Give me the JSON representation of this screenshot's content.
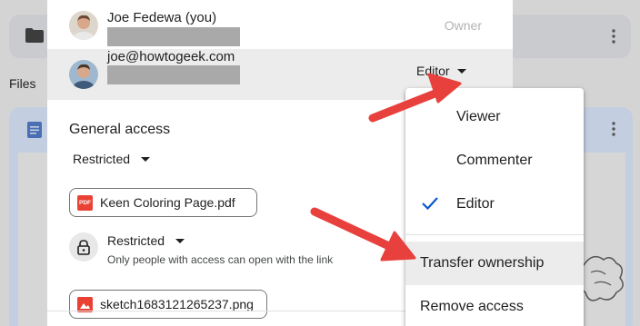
{
  "background": {
    "files_label": "Files"
  },
  "people": [
    {
      "name": "Joe Fedewa (you)",
      "role": "Owner"
    },
    {
      "name": "joe@howtogeek.com",
      "role": "Editor"
    }
  ],
  "general_access": {
    "title": "General access",
    "setting": "Restricted"
  },
  "files": {
    "pdf_name": "Keen Coloring Page.pdf",
    "pdf_badge": "PDF",
    "image_name": "sketch1683121265237.png"
  },
  "link_access": {
    "setting": "Restricted",
    "description": "Only people with access can open with the link"
  },
  "role_menu": {
    "items": [
      "Viewer",
      "Commenter",
      "Editor"
    ],
    "selected": "Editor",
    "transfer_label": "Transfer ownership",
    "remove_label": "Remove access"
  },
  "colors": {
    "accent": "#0b57d0",
    "arrow": "#e8413d",
    "pdf_red": "#e94235"
  },
  "icons": [
    "folder-icon",
    "kebab-icon",
    "document-icon",
    "pdf-icon",
    "image-icon",
    "lock-icon",
    "checkmark-icon",
    "dropdown-caret-icon",
    "annotation-arrow"
  ]
}
